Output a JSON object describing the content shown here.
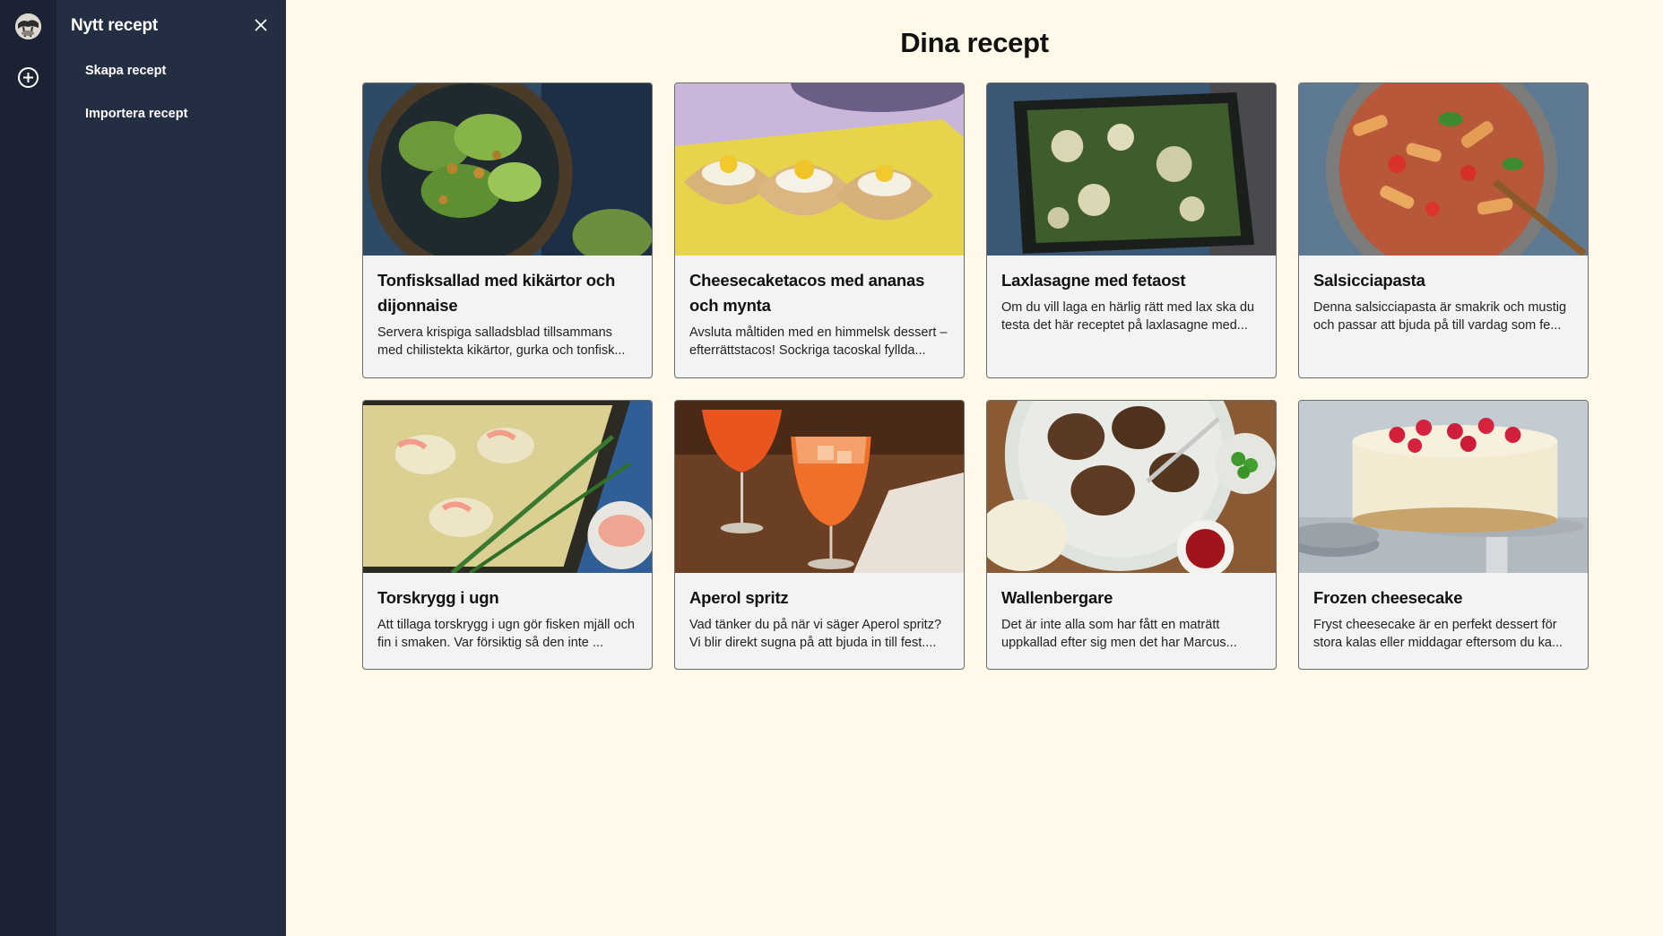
{
  "sidebar": {
    "avatar_icon": "user-avatar",
    "add_icon": "plus-circle-icon"
  },
  "drawer": {
    "title": "Nytt recept",
    "close_icon": "close-icon",
    "items": [
      {
        "label": "Skapa recept"
      },
      {
        "label": "Importera recept"
      }
    ]
  },
  "main": {
    "title": "Dina recept",
    "recipes": [
      {
        "title": "Tonfisksallad med kikärtor och dijonnaise",
        "description": "Servera krispiga salladsblad tillsammans med chilistekta kikärtor, gurka och tonfisk...",
        "image": "tuna-salad-photo"
      },
      {
        "title": "Cheesecaketacos med ananas och mynta",
        "description": "Avsluta måltiden med en himmelsk dessert – efterrättstacos! Sockriga tacoskal fyllda...",
        "image": "cheesecake-tacos-photo"
      },
      {
        "title": "Laxlasagne med fetaost",
        "description": "Om du vill laga en härlig rätt med lax ska du testa det här receptet på laxlasagne med...",
        "image": "salmon-lasagna-photo"
      },
      {
        "title": "Salsicciapasta",
        "description": "Denna salsicciapasta är smakrik och mustig och passar att bjuda på till vardag som fe...",
        "image": "salsiccia-pasta-photo"
      },
      {
        "title": "Torskrygg i ugn",
        "description": "Att tillaga torskrygg i ugn gör fisken mjäll och fin i smaken. Var försiktig så den inte ...",
        "image": "baked-cod-photo"
      },
      {
        "title": "Aperol spritz",
        "description": "Vad tänker du på när vi säger Aperol spritz? Vi blir direkt sugna på att bjuda in till fest....",
        "image": "aperol-spritz-photo"
      },
      {
        "title": "Wallenbergare",
        "description": "Det är inte alla som har fått en maträtt uppkallad efter sig men det har Marcus...",
        "image": "wallenbergare-photo"
      },
      {
        "title": "Frozen cheesecake",
        "description": "Fryst cheesecake är en perfekt dessert för stora kalas eller middagar eftersom du ka...",
        "image": "frozen-cheesecake-photo"
      }
    ]
  },
  "colors": {
    "rail": "#1a2233",
    "drawer": "#232e42",
    "background": "#fef9e8",
    "card": "#f3f3f3",
    "card_border": "#6c6c6c"
  }
}
